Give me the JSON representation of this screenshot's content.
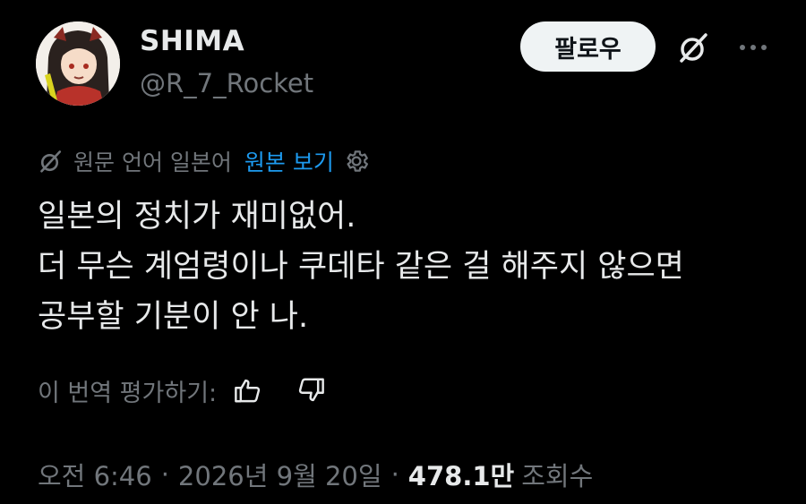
{
  "author": {
    "display_name": "SHIMA",
    "handle": "@R_7_Rocket"
  },
  "header": {
    "follow_label": "팔로우"
  },
  "translation": {
    "source_language_label": "원문 언어 일본어",
    "show_original_label": "원본 보기"
  },
  "tweet": {
    "lines": [
      "일본의 정치가 재미없어.",
      "더 무슨 계엄령이나 쿠데타 같은 걸 해주지 않으면",
      "공부할 기분이 안 나."
    ]
  },
  "rating": {
    "prompt": "이 번역 평가하기:"
  },
  "meta": {
    "time": "오전 6:46",
    "date": "2026년 9월 20일",
    "views_count": "478.1만",
    "views_label": "조회수"
  },
  "colors": {
    "background": "#000000",
    "text_primary": "#e7e9ea",
    "text_secondary": "#71767b",
    "link": "#1d9bf0",
    "follow_bg": "#eff3f4"
  },
  "icons": {
    "grok": "grok-icon",
    "more": "more-icon",
    "translate": "grok-icon",
    "settings": "gear-icon",
    "like": "thumbs-up-icon",
    "dislike": "thumbs-down-icon"
  }
}
